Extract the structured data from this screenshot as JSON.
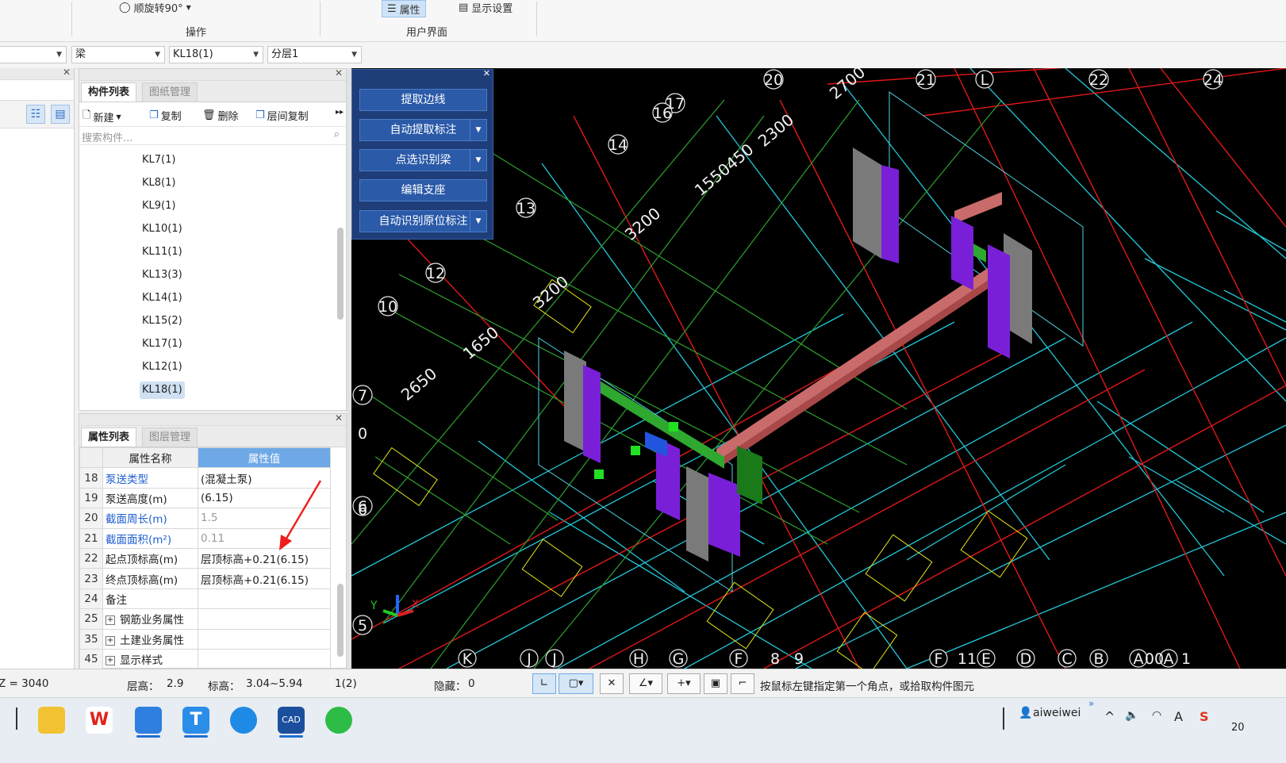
{
  "ribbon": {
    "rotate_label": "顺旋转90°",
    "group_operation": "操作",
    "group_ui": "用户界面",
    "attr_button": "属性",
    "display_settings": "显示设置"
  },
  "selectors": {
    "type": "梁",
    "component": "KL18(1)",
    "layer": "分层1"
  },
  "component_panel": {
    "tab_list": "构件列表",
    "tab_drawings": "图纸管理",
    "new": "新建",
    "copy": "复制",
    "delete": "删除",
    "floor_copy": "层间复制",
    "search_placeholder": "搜索构件...",
    "items": [
      "KL7(1)",
      "KL8(1)",
      "KL9(1)",
      "KL10(1)",
      "KL11(1)",
      "KL13(3)",
      "KL14(1)",
      "KL15(2)",
      "KL17(1)",
      "KL12(1)",
      "KL18(1)"
    ],
    "selected": "KL18(1)"
  },
  "property_panel": {
    "tab_props": "属性列表",
    "tab_layers": "图层管理",
    "col_name": "属性名称",
    "col_value": "属性值",
    "rows": [
      {
        "no": "18",
        "name": "泵送类型",
        "value": "(混凝土泵)"
      },
      {
        "no": "19",
        "name": "泵送高度(m)",
        "value": "(6.15)"
      },
      {
        "no": "20",
        "name": "截面周长(m)",
        "value": "1.5"
      },
      {
        "no": "21",
        "name": "截面面积(m²)",
        "value": "0.11"
      },
      {
        "no": "22",
        "name": "起点顶标高(m)",
        "value": "层顶标高+0.21(6.15)"
      },
      {
        "no": "23",
        "name": "终点顶标高(m)",
        "value": "层顶标高+0.21(6.15)"
      },
      {
        "no": "24",
        "name": "备注",
        "value": ""
      },
      {
        "no": "25",
        "name": "钢筋业务属性",
        "value": ""
      },
      {
        "no": "35",
        "name": "土建业务属性",
        "value": ""
      },
      {
        "no": "45",
        "name": "显示样式",
        "value": ""
      }
    ]
  },
  "toolbox": {
    "extract_edge": "提取边线",
    "auto_extract_label": "自动提取标注",
    "pick_beam": "点选识别梁",
    "edit_support": "编辑支座",
    "auto_identify_label": "自动识别原位标注"
  },
  "viewport": {
    "axis_numbers": [
      "20",
      "21",
      "22",
      "24",
      "17",
      "16",
      "14",
      "13",
      "12",
      "10",
      "7",
      "6",
      "5"
    ],
    "axis_letters": [
      "L",
      "K",
      "J",
      "J",
      "H",
      "G",
      "F",
      "F",
      "E",
      "D",
      "C",
      "B",
      "A",
      "A"
    ],
    "dims": [
      "2700",
      "2300",
      "1550450",
      "3200",
      "3200",
      "1650",
      "2650"
    ],
    "axis_labels": [
      "6",
      "8",
      "9",
      "11",
      "1",
      "0",
      "00"
    ]
  },
  "status": {
    "z": "Z = 3040",
    "floor_height": "层高：",
    "floor_height_val": "2.9",
    "elevation": "标高：",
    "elevation_val": "3.04~5.94",
    "count": "1(2)",
    "hidden": "隐藏：",
    "hidden_val": "0",
    "hint": "按鼠标左键指定第一个角点，或拾取构件图元"
  },
  "taskbar": {
    "user": "aiweiwei",
    "clock": "20"
  },
  "colors": {
    "viewport_bg": "#000000",
    "toolbox_bg": "#1f3d78",
    "selection_blue": "#6ea8e6",
    "beam_red": "#c86a6a",
    "column_purple": "#7a1fd8",
    "beam_green": "#2fa82f"
  }
}
